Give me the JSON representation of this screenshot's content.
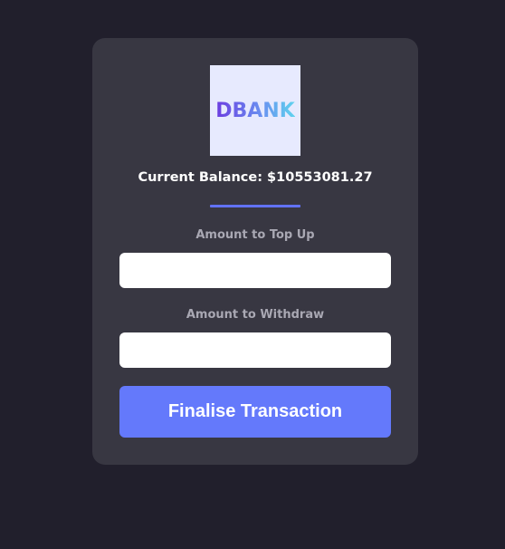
{
  "logo": {
    "text": "DBANK",
    "gradient_colors": [
      "#6b3ce0",
      "#6a8cf0",
      "#5fd3ee"
    ],
    "background": "#e7eafe"
  },
  "balance": {
    "label": "Current Balance: $10553081.27"
  },
  "form": {
    "topup_label": "Amount to Top Up",
    "topup_value": "",
    "withdraw_label": "Amount to Withdraw",
    "withdraw_value": "",
    "submit_label": "Finalise Transaction"
  },
  "colors": {
    "page_background": "#211f2c",
    "card_background": "#383742",
    "accent": "#6479fb",
    "label_text": "#a9a8b3"
  }
}
